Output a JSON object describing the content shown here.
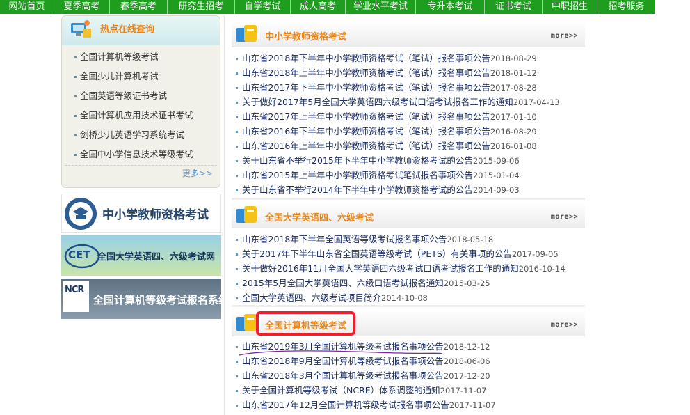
{
  "nav": {
    "items": [
      "网站首页",
      "夏季高考",
      "春季高考",
      "研究生招考",
      "自学考试",
      "成人高考",
      "学业水平考试",
      "专升本考试",
      "证书考试",
      "中职招生",
      "招考服务"
    ]
  },
  "hot": {
    "title": "热点在线查询",
    "items": [
      "全国计算机等级考试",
      "全国少儿计算机考试",
      "全国英语等级证书考试",
      "全国计算机应用技术证书考试",
      "剑桥少儿英语学习系统考试",
      "全国中小学信息技术等级考试"
    ],
    "more": "更多>>"
  },
  "banners": {
    "teacher": "中小学教师资格考试",
    "cet_logo": "CET",
    "cet": "全国大学英语四、六级考试网",
    "ncre_logo": "NCR",
    "ncre": "全国计算机等级考试报名系统"
  },
  "sections": [
    {
      "title": "中小学教师资格考试",
      "more": "more>>",
      "items": [
        {
          "text": "山东省2018年下半年中小学教师资格考试（笔试）报名事项公告",
          "date": "2018-08-29"
        },
        {
          "text": "山东省2018年上半年中小学教师资格考试（笔试）报名事项公告",
          "date": "2018-01-12"
        },
        {
          "text": "山东省2017年下半年中小学教师资格考试（笔试）报名事项公告",
          "date": "2017-08-28"
        },
        {
          "text": "关于做好2017年5月全国大学英语四六级考试口语考试报名工作的通知",
          "date": "2017-04-13"
        },
        {
          "text": "山东省2017年上半年中小学教师资格考试（笔试）报名事项公告",
          "date": "2017-01-10"
        },
        {
          "text": "山东省2016年下半年中小学教师资格考试（笔试）报名事项公告",
          "date": "2016-08-29"
        },
        {
          "text": "山东省2016年上半年中小学教师资格考试（笔试）报名事项公告",
          "date": "2016-01-08"
        },
        {
          "text": "关于山东省不举行2015年下半年中小学教师资格考试的公告",
          "date": "2015-09-06"
        },
        {
          "text": "山东省2015年上半年中小学教师资格考试笔试报名事项公告",
          "date": "2015-01-04"
        },
        {
          "text": "关于山东省不举行2014年下半年中小学教师资格考试的公告",
          "date": "2014-09-03"
        }
      ]
    },
    {
      "title": "全国大学英语四、六级考试",
      "more": "more>>",
      "items": [
        {
          "text": "山东省2018年下半年全国英语等级考试报名事项公告",
          "date": "2018-05-18"
        },
        {
          "text": "关于2017年下半年山东省全国英语等级考试（PETS）有关事项的公告",
          "date": "2017-09-05"
        },
        {
          "text": "关于做好2016年11月全国大学英语四六级考试口语考试报名工作的通知",
          "date": "2016-10-14"
        },
        {
          "text": "2015年5月全国大学英语四、六级口语考试报名通知",
          "date": "2015-03-25"
        },
        {
          "text": "全国大学英语四、六级考试项目简介",
          "date": "2014-10-08"
        }
      ]
    },
    {
      "title": "全国计算机等级考试",
      "more": "more>>",
      "items": [
        {
          "text": "山东省2019年3月全国计算机等级考试报名事项公告",
          "date": "2018-12-12"
        },
        {
          "text": "山东省2018年9月全国计算机等级考试报名事项公告",
          "date": "2018-06-06"
        },
        {
          "text": "山东省2018年3月全国计算机等级考试报名事项公告",
          "date": "2017-12-20"
        },
        {
          "text": "关于全国计算机等级考试（NCRE）体系调整的通知",
          "date": "2017-11-07"
        },
        {
          "text": "山东省2017年12月全国计算机等级考试报名事项公告",
          "date": "2017-11-07"
        }
      ]
    }
  ],
  "colors": {
    "nav_bg": "#1e9d1e",
    "title_orange": "#e8861b",
    "link_blue": "#1d2f66",
    "annotation_red": "#f31e2a",
    "annotation_purple": "#7a2a9a"
  }
}
